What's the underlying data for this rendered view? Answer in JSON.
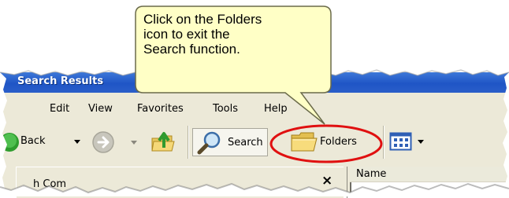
{
  "callout": {
    "text_line1": "Click on the Folders",
    "text_line2": "icon to exit the",
    "text_line3": "Search function."
  },
  "window": {
    "title": "Search Results"
  },
  "menu": {
    "items": [
      {
        "label": "Edit"
      },
      {
        "label": "View"
      },
      {
        "label": "Favorites"
      },
      {
        "label": "Tools"
      },
      {
        "label": "Help"
      }
    ]
  },
  "toolbar": {
    "back_label": "Back",
    "search_label": "Search",
    "folders_label": "Folders"
  },
  "pane": {
    "left_title": "h Com",
    "close_glyph": "×",
    "column_name": "Name"
  },
  "colors": {
    "titlebar": "#2a5ec9",
    "highlight": "#e01010",
    "callout_fill": "#ffffc6"
  }
}
